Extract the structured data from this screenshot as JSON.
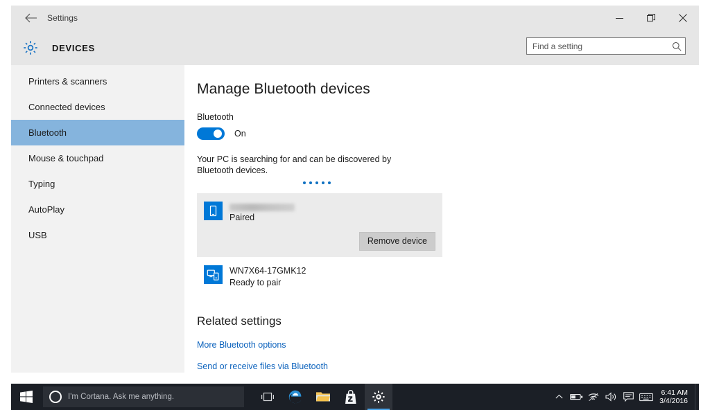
{
  "window": {
    "titlebar_label": "Settings",
    "back_icon": "back-arrow-icon",
    "minimize_icon": "minimize-icon",
    "maximize_icon": "restore-icon",
    "close_icon": "close-icon"
  },
  "header": {
    "gear_icon": "gear-icon",
    "title": "DEVICES",
    "search_placeholder": "Find a setting",
    "search_value": "",
    "search_icon": "search-icon"
  },
  "sidebar": {
    "items": [
      {
        "label": "Printers & scanners",
        "selected": false
      },
      {
        "label": "Connected devices",
        "selected": false
      },
      {
        "label": "Bluetooth",
        "selected": true
      },
      {
        "label": "Mouse & touchpad",
        "selected": false
      },
      {
        "label": "Typing",
        "selected": false
      },
      {
        "label": "AutoPlay",
        "selected": false
      },
      {
        "label": "USB",
        "selected": false
      }
    ],
    "selected_color": "#85b4dd",
    "background": "#f2f2f2"
  },
  "main": {
    "heading": "Manage Bluetooth devices",
    "bluetooth_label": "Bluetooth",
    "toggle_state": "On",
    "toggle_on": true,
    "toggle_color": "#0078d7",
    "status_text": "Your PC is searching for and can be discovered by Bluetooth devices.",
    "progress_dots": 5,
    "devices": [
      {
        "name": "",
        "name_redacted": true,
        "status": "Paired",
        "icon": "phone-icon",
        "selected": true,
        "action_label": "Remove device"
      },
      {
        "name": "WN7X64-17GMK12",
        "name_redacted": false,
        "status": "Ready to pair",
        "icon": "connected-devices-icon",
        "selected": false,
        "action_label": ""
      }
    ],
    "related_heading": "Related settings",
    "related_links": [
      "More Bluetooth options",
      "Send or receive files via Bluetooth"
    ],
    "link_color": "#0d63bd"
  },
  "taskbar": {
    "start_icon": "windows-start-icon",
    "cortana_placeholder": "I'm Cortana. Ask me anything.",
    "cortana_icon": "cortana-circle-icon",
    "apps": [
      {
        "name": "task-view-icon",
        "active": false
      },
      {
        "name": "edge-browser-icon",
        "active": false
      },
      {
        "name": "file-explorer-icon",
        "active": false
      },
      {
        "name": "microsoft-store-icon",
        "active": false
      },
      {
        "name": "settings-icon",
        "active": true
      }
    ],
    "tray": [
      "show-hidden-icons-chevron",
      "battery-icon",
      "wifi-icon",
      "volume-icon",
      "action-center-icon",
      "touch-keyboard-icon"
    ],
    "time": "6:41 AM",
    "date": "3/4/2016",
    "background": "#1b1f26"
  }
}
